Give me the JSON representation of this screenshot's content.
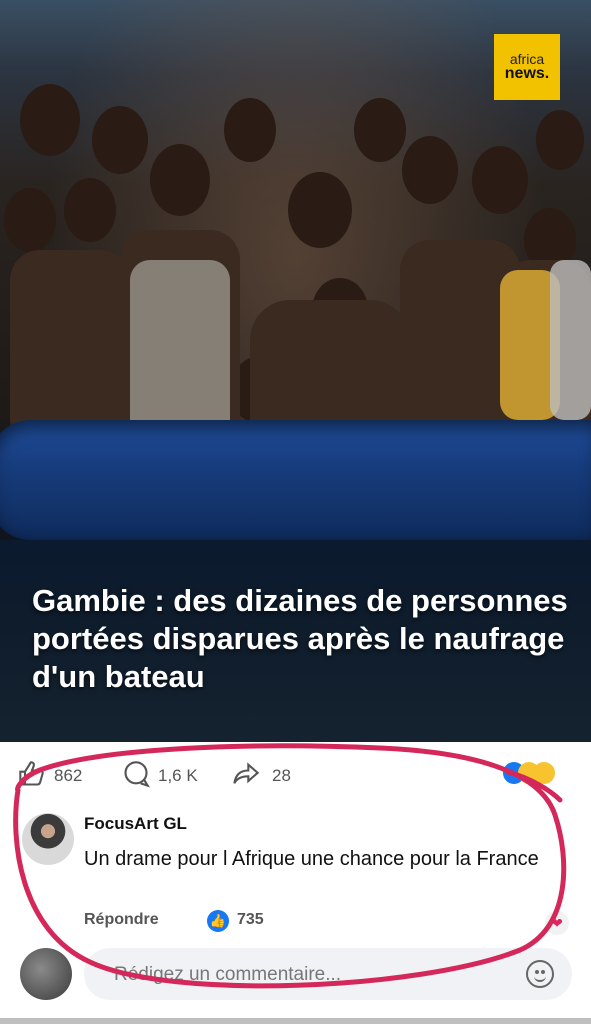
{
  "post": {
    "source_logo": {
      "line1": "africa",
      "line2": "news."
    },
    "headline": "Gambie : des dizaines de personnes portées disparues après le naufrage d'un bateau"
  },
  "reactions": {
    "likes": "862",
    "comments": "1,6 K",
    "shares": "28",
    "icons": [
      "like-icon",
      "comment-icon",
      "share-icon",
      "reaction-like-emoji",
      "reaction-haha-emoji",
      "reaction-sad-emoji"
    ]
  },
  "comment": {
    "author": "FocusArt GL",
    "text": "Un drame pour l Afrique une chance pour la France",
    "reply_label": "Répondre",
    "like_count": "735"
  },
  "composer": {
    "placeholder": "Rédigez un commentaire..."
  },
  "colors": {
    "annotation_circle": "#d4285a",
    "raft_blue": "#1f4d9a",
    "logo_yellow": "#f2c200",
    "like_blue": "#1877f2"
  }
}
